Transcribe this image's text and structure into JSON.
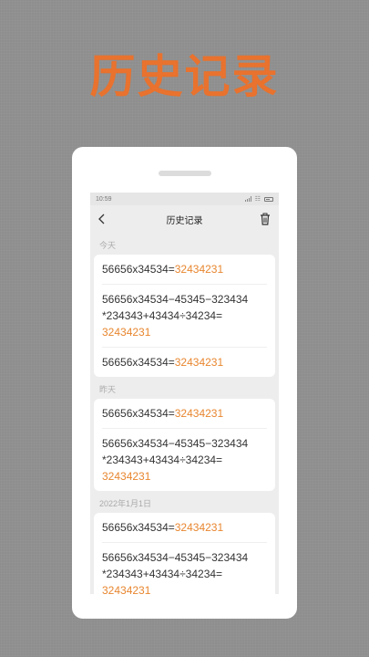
{
  "hero": {
    "title": "历史记录"
  },
  "status": {
    "time": "10:59"
  },
  "nav": {
    "title": "历史记录"
  },
  "colors": {
    "accent": "#e8722e",
    "result": "#e8862f"
  },
  "groups": [
    {
      "label": "今天",
      "records": [
        {
          "expr": "56656x34534=",
          "result": "32434231"
        },
        {
          "expr_line1": "56656x34534−45345−323434",
          "expr_line2": "*234343+43434÷34234=",
          "result": "32434231"
        },
        {
          "expr": "56656x34534=",
          "result": "32434231"
        }
      ]
    },
    {
      "label": "昨天",
      "records": [
        {
          "expr": "56656x34534=",
          "result": "32434231"
        },
        {
          "expr_line1": "56656x34534−45345−323434",
          "expr_line2": "*234343+43434÷34234=",
          "result": "32434231"
        }
      ]
    },
    {
      "label": "2022年1月1日",
      "records": [
        {
          "expr": "56656x34534=",
          "result": "32434231"
        },
        {
          "expr_line1": "56656x34534−45345−323434",
          "expr_line2": "*234343+43434÷34234=",
          "result": "32434231"
        }
      ]
    }
  ]
}
